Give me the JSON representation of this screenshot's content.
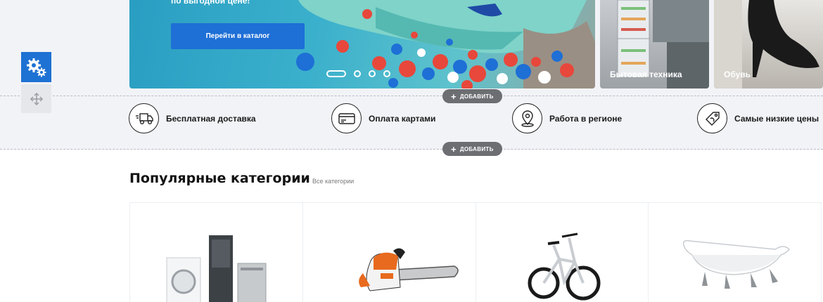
{
  "hero": {
    "title": "по выгодной цене!",
    "button_label": "Перейти в каталог",
    "slides_total": 4,
    "active_slide": 1
  },
  "banners": [
    {
      "label": "Бытовая техника"
    },
    {
      "label": "Обувь"
    }
  ],
  "admin": {
    "add_label": "ДОБАВИТЬ"
  },
  "features": [
    {
      "label": "Бесплатная доставка",
      "icon": "delivery-truck-icon"
    },
    {
      "label": "Оплата картами",
      "icon": "credit-card-icon"
    },
    {
      "label": "Работа в регионе",
      "icon": "map-pin-icon"
    },
    {
      "label": "Самые низкие цены",
      "icon": "price-tag-icon"
    }
  ],
  "popular": {
    "title": "Популярные категории",
    "all_link": "Все категории",
    "tiles": [
      {
        "icon": "appliances-image"
      },
      {
        "icon": "chainsaw-image"
      },
      {
        "icon": "bicycle-image"
      },
      {
        "icon": "bathtub-image"
      }
    ]
  },
  "colors": {
    "accent": "#1e72d3",
    "band": "#f2f3f7",
    "add_button": "#6c6e72"
  }
}
